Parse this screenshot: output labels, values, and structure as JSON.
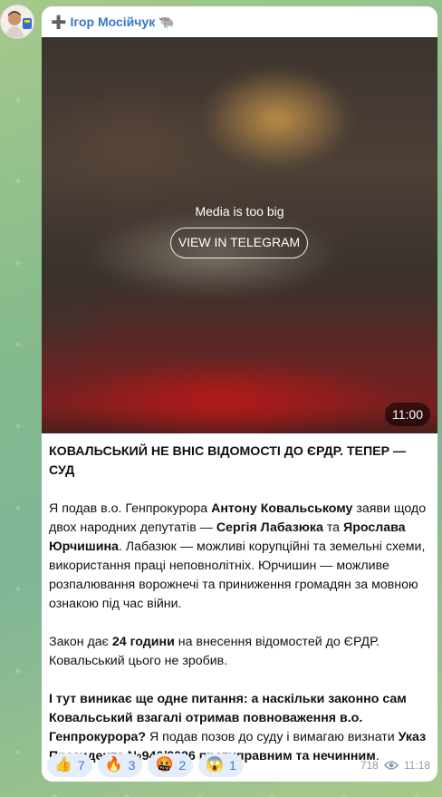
{
  "channel": {
    "author_name": "Ігор Мосійчук",
    "author_prefix_icon": "red-cross-icon",
    "author_suffix_icon": "bison-emoji-icon"
  },
  "media": {
    "notice": "Media is too big",
    "button_label": "VIEW IN TELEGRAM",
    "duration": "11:00"
  },
  "post": {
    "title": "КОВАЛЬСЬКИЙ НЕ ВНІС ВІДОМОСТІ ДО ЄРДР. ТЕПЕР — СУД",
    "p1_a": "Я подав в.о. Генпрокурора ",
    "p1_b": "Антону Ковальському",
    "p1_c": " заяви щодо двох народних депутатів — ",
    "p1_d": "Сергія Лабазюка",
    "p1_e": " та ",
    "p1_f": "Ярослава Юрчишина",
    "p1_g": ". Лабазюк — можливі корупційні та земельні схеми, використання праці неповнолітніх. Юрчишин — можливе розпалювання ворожнечі та приниження громадян за мовною ознакою під час війни.",
    "p2_a": "Закон дає ",
    "p2_b": "24 години",
    "p2_c": " на внесення відомостей до ЄРДР. Ковальський цього не зробив.",
    "p3_a": "І тут виникає ще одне питання: а наскільки законно сам Ковальський взагалі отримав повноваження в.о. Генпрокурора?",
    "p3_b": " Я подав позов до суду і вимагаю визнати ",
    "p3_c": "Указ Президента №946/2026 протиправним та нечинним",
    "p3_d": "."
  },
  "reactions": [
    {
      "emoji": "👍",
      "icon": "thumbs-up-icon",
      "count": "7"
    },
    {
      "emoji": "🔥",
      "icon": "fire-icon",
      "count": "3"
    },
    {
      "emoji": "🤬",
      "icon": "angry-face-icon",
      "count": "2"
    },
    {
      "emoji": "😱",
      "icon": "scream-face-icon",
      "count": "1"
    }
  ],
  "meta": {
    "views": "718",
    "time": "11:18"
  }
}
